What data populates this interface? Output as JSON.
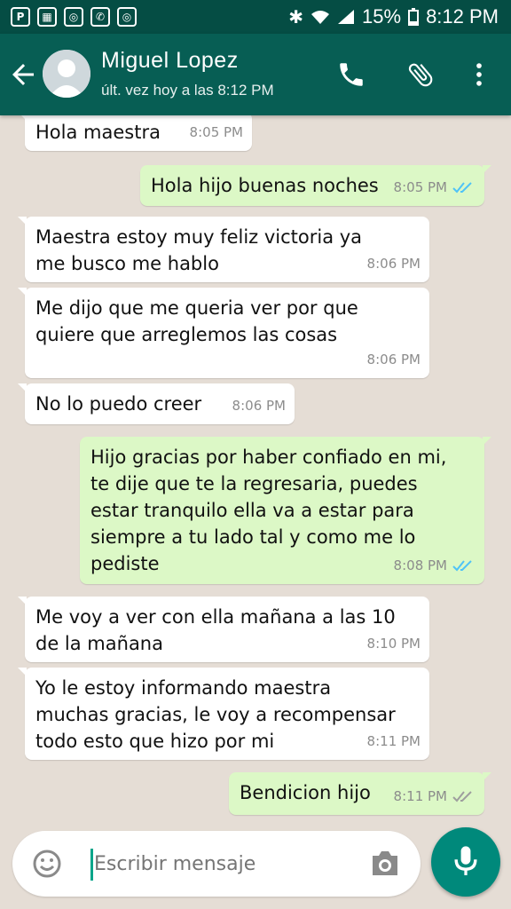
{
  "status_bar": {
    "battery": "15%",
    "time": "8:12 PM",
    "left_icons": [
      "pinterest-icon",
      "grid-icon",
      "instagram-icon",
      "phone-alert-icon",
      "instagram-icon"
    ]
  },
  "header": {
    "contact_name": "Miguel Lopez",
    "last_seen": "últ. vez hoy a las 8:12 PM"
  },
  "messages": [
    {
      "direction": "in",
      "lines": [
        "Hola maestra"
      ],
      "time": "8:05 PM"
    },
    {
      "direction": "out",
      "lines": [
        "Hola hijo buenas noches"
      ],
      "time": "8:05 PM",
      "status": "read"
    },
    {
      "direction": "in",
      "lines": [
        "Maestra estoy muy feliz victoria ya",
        "me busco me hablo"
      ],
      "time": "8:06 PM"
    },
    {
      "direction": "in",
      "lines": [
        "Me dijo que me queria ver por que",
        "quiere que arreglemos las cosas"
      ],
      "time": "8:06 PM"
    },
    {
      "direction": "in",
      "lines": [
        "No lo puedo creer"
      ],
      "time": "8:06 PM"
    },
    {
      "direction": "out",
      "lines": [
        "Hijo gracias por haber confiado en mi,",
        "te dije que te la regresaria, puedes",
        "estar tranquilo ella va a estar para",
        "siempre a tu lado tal y como me lo",
        "pediste"
      ],
      "time": "8:08 PM",
      "status": "read"
    },
    {
      "direction": "in",
      "lines": [
        "Me voy a ver con ella mañana a las 10",
        "de la mañana"
      ],
      "time": "8:10 PM"
    },
    {
      "direction": "in",
      "lines": [
        "Yo le estoy informando maestra",
        "muchas gracias, le voy a recompensar",
        "todo esto que hizo por mi"
      ],
      "time": "8:11 PM"
    },
    {
      "direction": "out",
      "lines": [
        "Bendicion hijo"
      ],
      "time": "8:11 PM",
      "status": "delivered"
    }
  ],
  "composer": {
    "placeholder": "Escribir mensaje"
  },
  "colors": {
    "header": "#075e54",
    "status_bar": "#054d44",
    "outgoing_bubble": "#dcf8c6",
    "incoming_bubble": "#ffffff",
    "read_ticks": "#4fc3f7",
    "mic_button": "#00897b"
  }
}
